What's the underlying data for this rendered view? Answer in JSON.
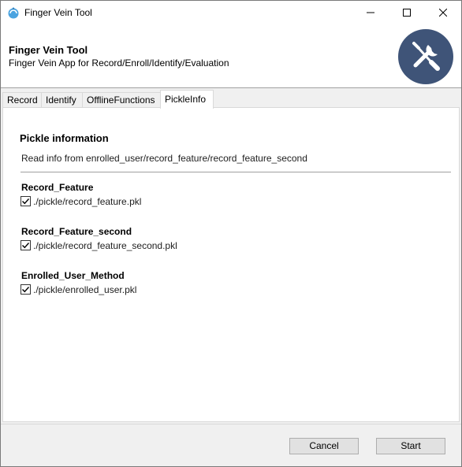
{
  "window": {
    "title": "Finger Vein Tool"
  },
  "header": {
    "title": "Finger Vein Tool",
    "subtitle": "Finger Vein App for Record/Enroll/Identify/Evaluation",
    "badge_icon": "tools-icon",
    "badge_color": "#3f5478"
  },
  "tabs": [
    {
      "label": "Record"
    },
    {
      "label": "Identify"
    },
    {
      "label": "OfflineFunctions"
    },
    {
      "label": "PickleInfo",
      "active": true
    }
  ],
  "panel": {
    "title": "Pickle information",
    "description": "Read info from enrolled_user/record_feature/record_feature_second",
    "groups": [
      {
        "label": "Record_Feature",
        "path": "./pickle/record_feature.pkl",
        "checked": true
      },
      {
        "label": "Record_Feature_second",
        "path": "./pickle/record_feature_second.pkl",
        "checked": true
      },
      {
        "label": "Enrolled_User_Method",
        "path": "./pickle/enrolled_user.pkl",
        "checked": true
      }
    ]
  },
  "footer": {
    "cancel_label": "Cancel",
    "start_label": "Start"
  }
}
